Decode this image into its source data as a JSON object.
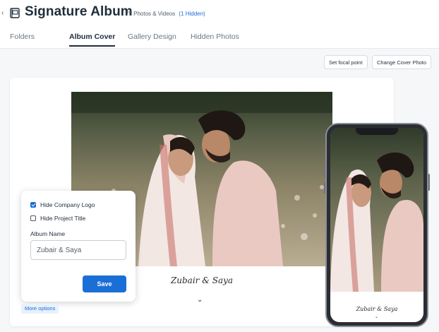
{
  "header": {
    "title": "Signature Album",
    "subtitle": "75 Photos & Videos",
    "hidden_link": "(1 Hidden)"
  },
  "tabs": [
    {
      "label": "Folders",
      "active": false
    },
    {
      "label": "Album Cover",
      "active": true
    },
    {
      "label": "Gallery Design",
      "active": false
    },
    {
      "label": "Hidden Photos",
      "active": false
    }
  ],
  "toolbar": {
    "focal_label": "Set focal point",
    "change_cover_label": "Change Cover Photo"
  },
  "cover": {
    "couple_name": "Zubair & Saya"
  },
  "options": {
    "hide_logo": {
      "label": "Hide Company Logo",
      "checked": true
    },
    "hide_title": {
      "label": "Hide Project Title",
      "checked": false
    },
    "album_name_label": "Album Name",
    "album_name_value": "Zubair & Saya",
    "save_label": "Save",
    "more_options_label": "More options"
  },
  "colors": {
    "accent": "#1a6fd6",
    "text": "#1f2d3d"
  }
}
